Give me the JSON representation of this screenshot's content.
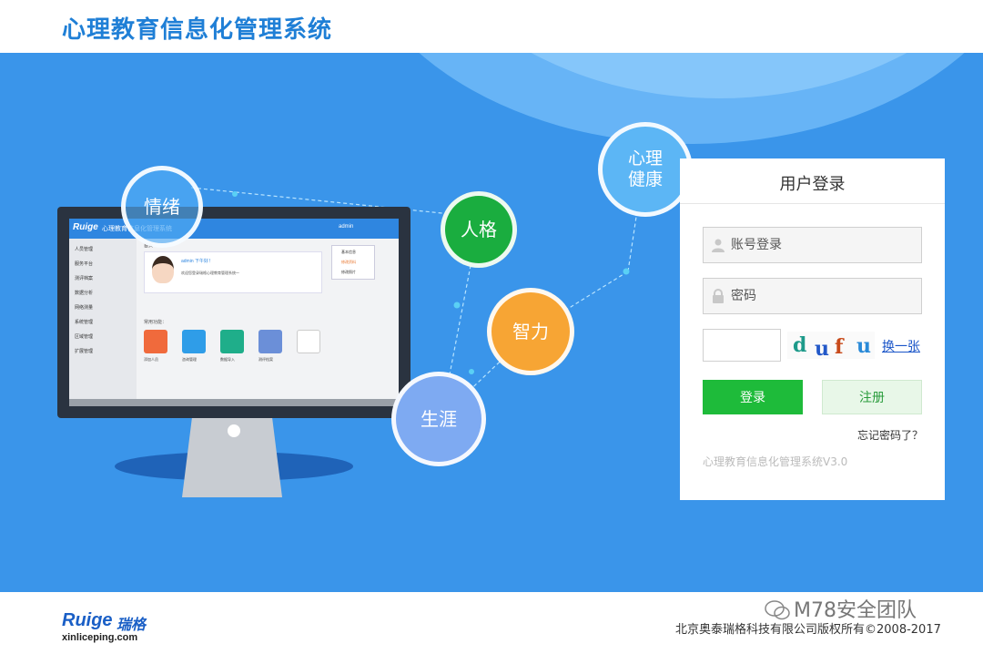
{
  "header": {
    "title": "心理教育信息化管理系统"
  },
  "bubbles": {
    "emotion": "情绪",
    "personality": "人格",
    "mental_health_1": "心理",
    "mental_health_2": "健康",
    "intelligence": "智力",
    "career": "生涯"
  },
  "monitor": {
    "logo": "Ruige",
    "title": "心理教育信息化管理系统",
    "user": "admin",
    "sidebar": [
      "人员管理",
      "服务平台",
      "测评档案",
      "数据分析",
      "网络测量",
      "系统管理",
      "区域管理",
      "扩展管理"
    ],
    "crumb": "首页",
    "welcome_title": "admin 下午好！",
    "welcome_text": "欢迎您登录瑞格心理教育管理系统～",
    "dropdown": [
      "基本信息",
      "修改资料",
      "修改照片"
    ],
    "shortcut_label": "常用功能：",
    "tiles": [
      {
        "label": "添加人员",
        "color": "#f06a3c"
      },
      {
        "label": "咨询管理",
        "color": "#2f9de8"
      },
      {
        "label": "数据导入",
        "color": "#1fae8a"
      },
      {
        "label": "测评档案",
        "color": "#6b8fd8"
      }
    ]
  },
  "login": {
    "title": "用户登录",
    "username_placeholder": "账号登录",
    "password_placeholder": "密码",
    "captcha_letters": [
      "d",
      "u",
      "f",
      "u"
    ],
    "captcha_colors": [
      "#1d9a8a",
      "#2258c8",
      "#c84a1a",
      "#2a8ad8"
    ],
    "captcha_refresh": "换一张",
    "login_button": "登录",
    "register_button": "注册",
    "forgot": "忘记密码了？",
    "version": "心理教育信息化管理系统V3.0"
  },
  "footer": {
    "brand": "Ruige",
    "brand_cn": "瑞格",
    "site": "xinliceping.com",
    "copyright": "北京奥泰瑞格科技有限公司版权所有©2008-2017",
    "watermark": "M78安全团队"
  },
  "colors": {
    "hero_bg": "#3a95ea",
    "title_blue": "#1f7fd6",
    "login_green": "#1ebb3a",
    "bubble_green": "#1aad3f",
    "bubble_orange": "#f7a534",
    "bubble_lightblue": "#5cb6f5",
    "bubble_periwinkle": "#7eaaf2"
  }
}
